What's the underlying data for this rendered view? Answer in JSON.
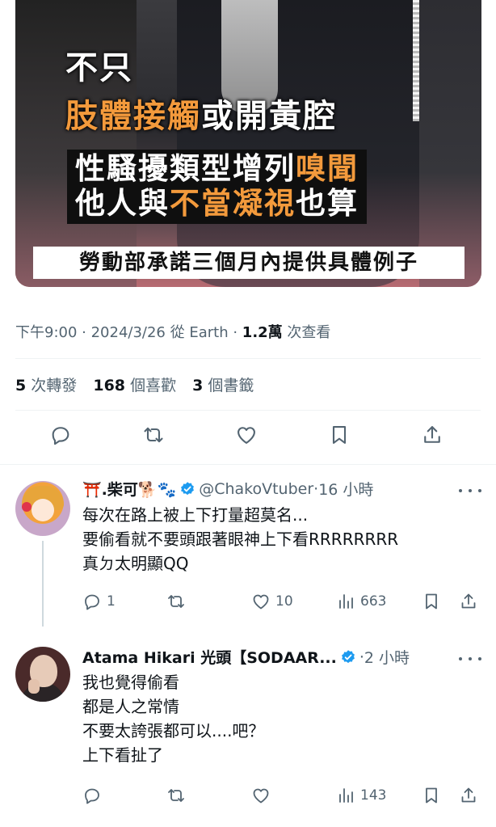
{
  "media": {
    "caption_line1": "不只",
    "caption_line2_highlight": "肢體接觸",
    "caption_line2_rest": "或開黃腔",
    "caption_line3_a": "性騷擾類型增列",
    "caption_line3_highlight": "嗅聞",
    "caption_line4_a": "他人與",
    "caption_line4_highlight": "不當凝視",
    "caption_line4_b": "也算",
    "caption_strip": "勞動部承諾三個月內提供具體例子"
  },
  "meta": {
    "time": "下午9:00",
    "date": "2024/3/26",
    "source": "從 Earth",
    "views_count": "1.2萬",
    "views_label": "次查看"
  },
  "stats": {
    "reposts_count": "5",
    "reposts_label": "次轉發",
    "likes_count": "168",
    "likes_label": "個喜歡",
    "bookmarks_count": "3",
    "bookmarks_label": "個書籤"
  },
  "replies": [
    {
      "name": "⛩️.柴可🐕🐾",
      "handle": "@ChakoVtuber",
      "time": "16 小時",
      "text": "每次在路上被上下打量超莫名...\n要偷看就不要頭跟著眼神上下看RRRRRRRR\n真ㄉ太明顯QQ",
      "replies": "1",
      "retweets": "",
      "likes": "10",
      "views": "663"
    },
    {
      "name": "Atama Hikari 光頭【SODAAR...",
      "handle": "",
      "time": "2 小時",
      "text": "我也覺得偷看\n都是人之常情\n不要太誇張都可以....吧？\n上下看扯了",
      "replies": "",
      "retweets": "",
      "likes": "",
      "views": "143"
    }
  ],
  "colors": {
    "accent_orange": "#f39a3c",
    "verified_blue": "#1d9bf0",
    "secondary_text": "#536471"
  }
}
